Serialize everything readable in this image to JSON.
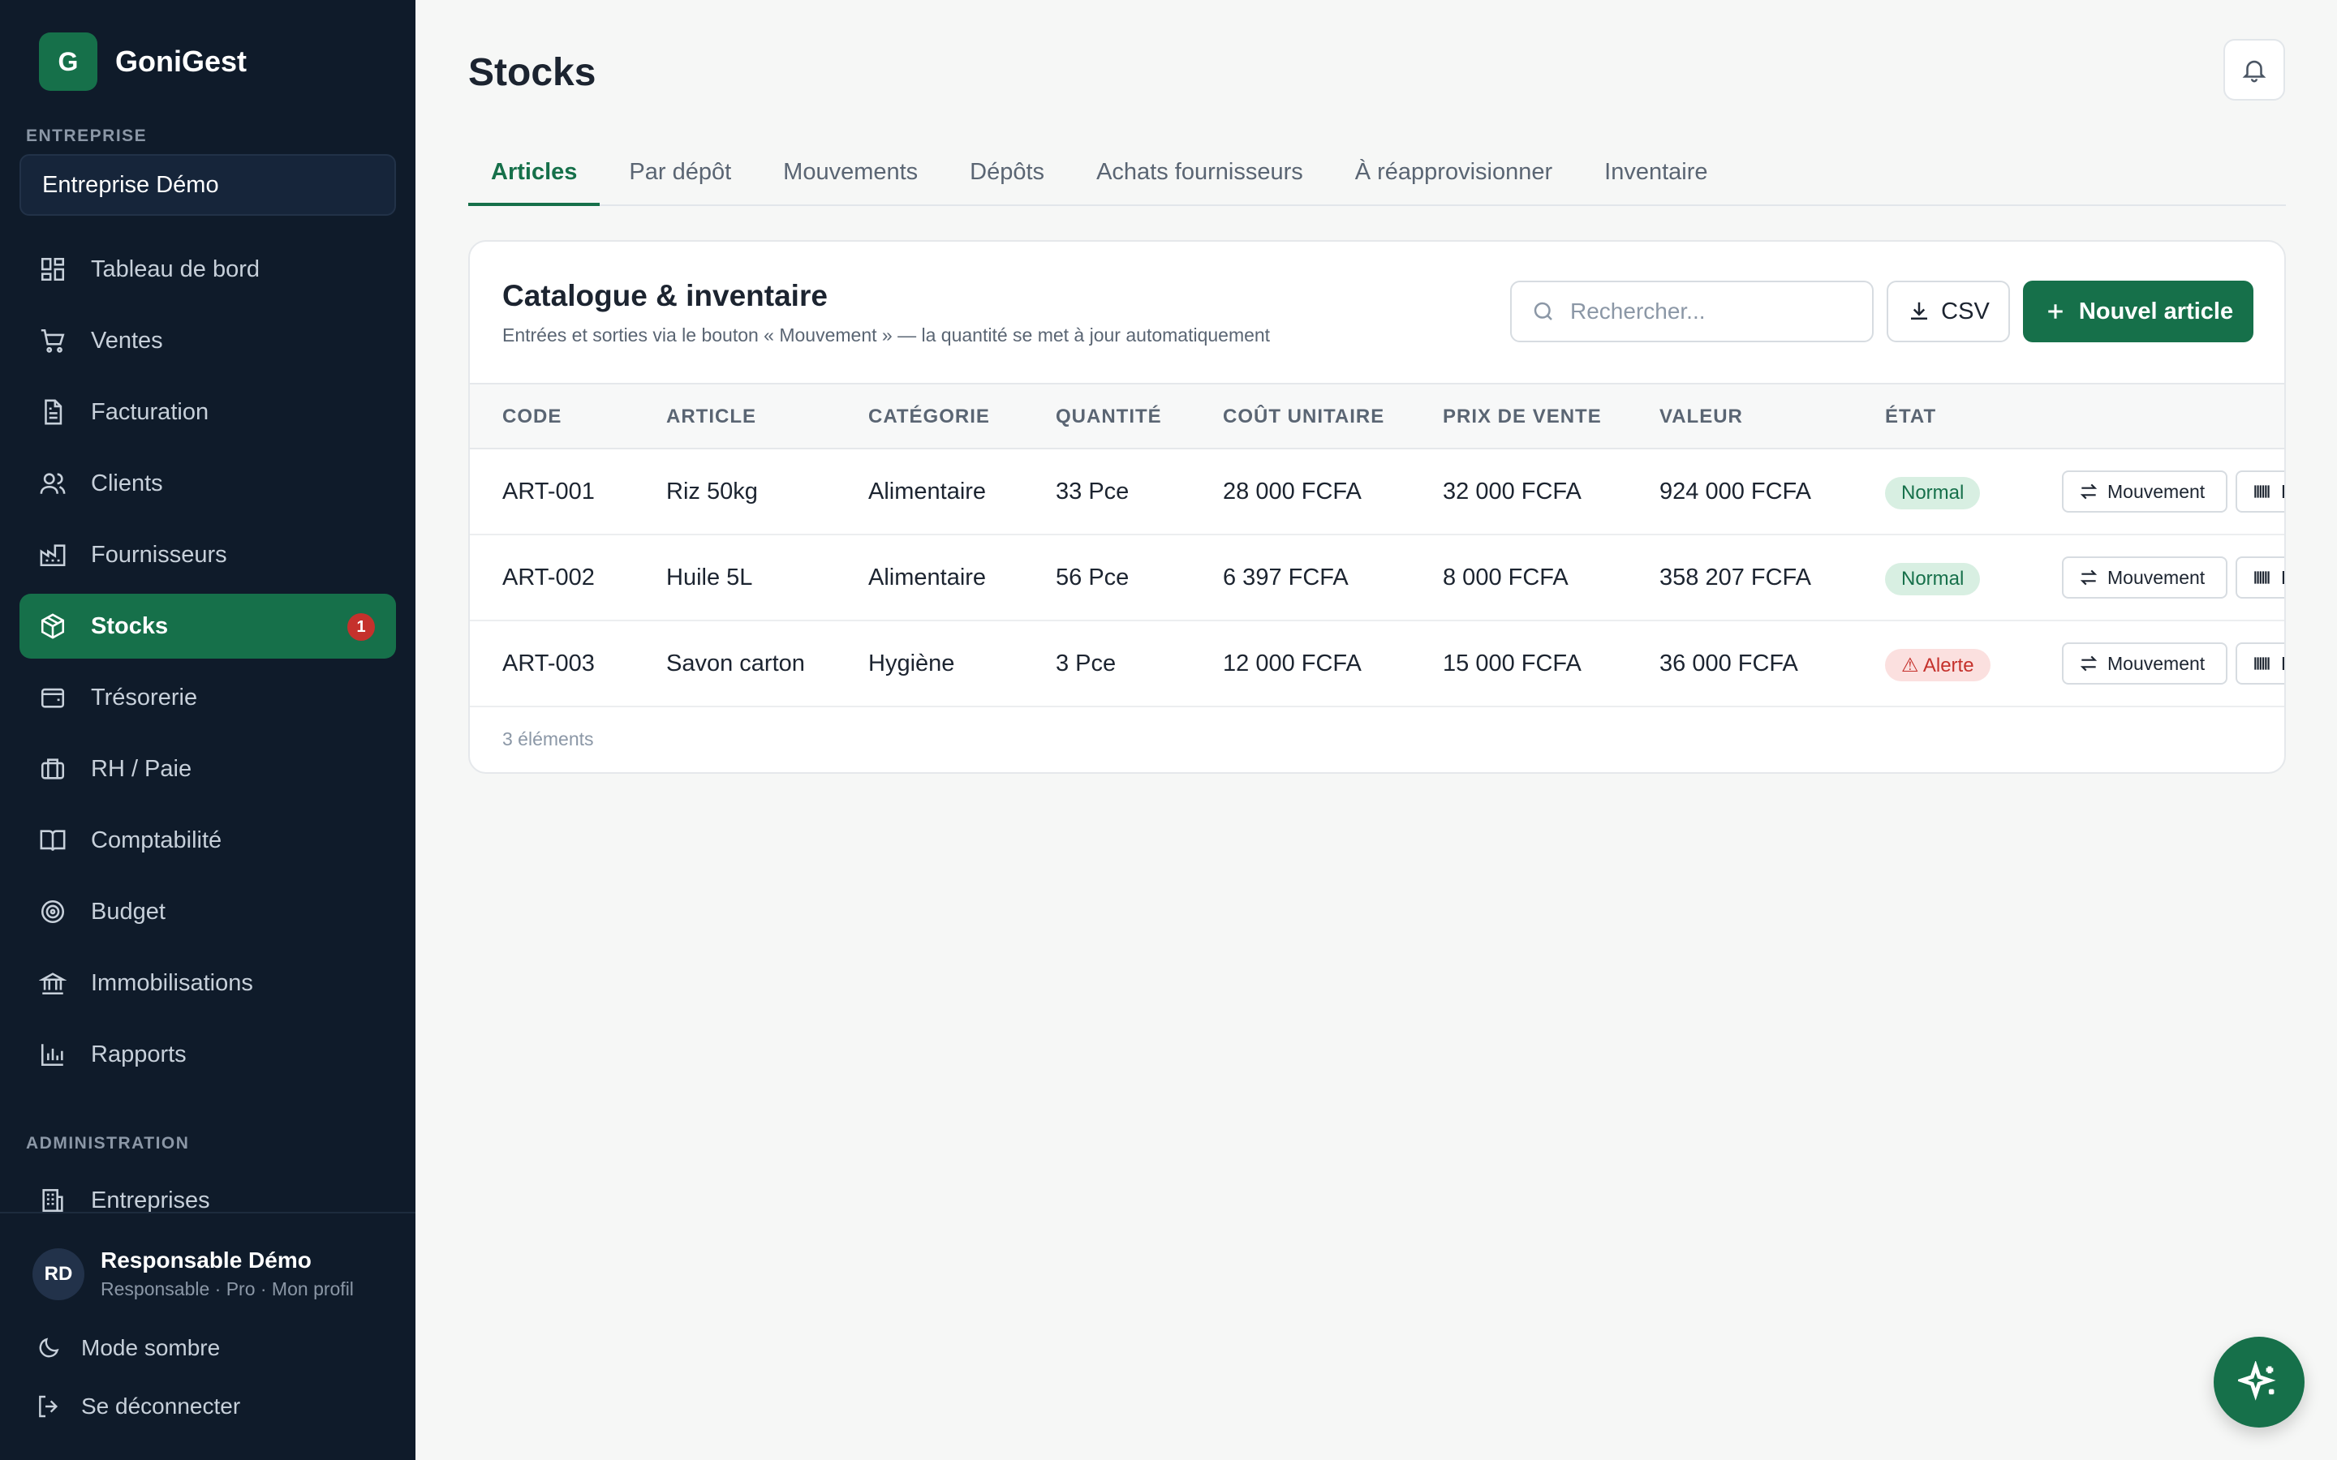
{
  "app": {
    "logo_letter": "G",
    "name": "GoniGest"
  },
  "sidebar": {
    "company_label": "ENTREPRISE",
    "company_value": "Entreprise Démo",
    "items": [
      {
        "label": "Tableau de bord",
        "icon": "dashboard-icon"
      },
      {
        "label": "Ventes",
        "icon": "cart-icon"
      },
      {
        "label": "Facturation",
        "icon": "document-icon"
      },
      {
        "label": "Clients",
        "icon": "users-icon"
      },
      {
        "label": "Fournisseurs",
        "icon": "factory-icon"
      },
      {
        "label": "Stocks",
        "icon": "package-icon",
        "badge": "1",
        "active": true
      },
      {
        "label": "Trésorerie",
        "icon": "wallet-icon"
      },
      {
        "label": "RH / Paie",
        "icon": "briefcase-icon"
      },
      {
        "label": "Comptabilité",
        "icon": "book-icon"
      },
      {
        "label": "Budget",
        "icon": "target-icon"
      },
      {
        "label": "Immobilisations",
        "icon": "bank-icon"
      },
      {
        "label": "Rapports",
        "icon": "bar-chart-icon"
      }
    ],
    "admin_label": "ADMINISTRATION",
    "admin_items": [
      {
        "label": "Entreprises",
        "icon": "building-icon"
      }
    ],
    "user": {
      "initials": "RD",
      "name": "Responsable Démo",
      "subtitle": "Responsable · Pro · Mon profil"
    },
    "dark_mode_label": "Mode sombre",
    "logout_label": "Se déconnecter"
  },
  "page": {
    "title": "Stocks"
  },
  "tabs": [
    "Articles",
    "Par dépôt",
    "Mouvements",
    "Dépôts",
    "Achats fournisseurs",
    "À réapprovisionner",
    "Inventaire"
  ],
  "active_tab": "Articles",
  "card": {
    "title": "Catalogue & inventaire",
    "subtitle": "Entrées et sorties via le bouton « Mouvement » — la quantité se met à jour automatiquement",
    "search_placeholder": "Rechercher...",
    "csv_label": "CSV",
    "new_label": "Nouvel article"
  },
  "table": {
    "columns": [
      "CODE",
      "ARTICLE",
      "CATÉGORIE",
      "QUANTITÉ",
      "COÛT UNITAIRE",
      "PRIX DE VENTE",
      "VALEUR",
      "ÉTAT"
    ],
    "rows": [
      {
        "code": "ART-001",
        "article": "Riz 50kg",
        "categorie": "Alimentaire",
        "quantite": "33 Pce",
        "cout": "28 000 FCFA",
        "prix": "32 000 FCFA",
        "valeur": "924 000 FCFA",
        "etat": "Normal",
        "etat_type": "normal"
      },
      {
        "code": "ART-002",
        "article": "Huile 5L",
        "categorie": "Alimentaire",
        "quantite": "56 Pce",
        "cout": "6 397 FCFA",
        "prix": "8 000 FCFA",
        "valeur": "358 207 FCFA",
        "etat": "Normal",
        "etat_type": "normal"
      },
      {
        "code": "ART-003",
        "article": "Savon carton",
        "categorie": "Hygiène",
        "quantite": "3 Pce",
        "cout": "12 000 FCFA",
        "prix": "15 000 FCFA",
        "valeur": "36 000 FCFA",
        "etat": "⚠ Alerte",
        "etat_type": "alert"
      }
    ],
    "row_action_label": "Mouvement",
    "row_action2_label": "E",
    "count_label": "3 éléments"
  },
  "colors": {
    "accent": "#16704a",
    "sidebar_bg": "#0f1b2a",
    "alert": "#c5312c"
  }
}
